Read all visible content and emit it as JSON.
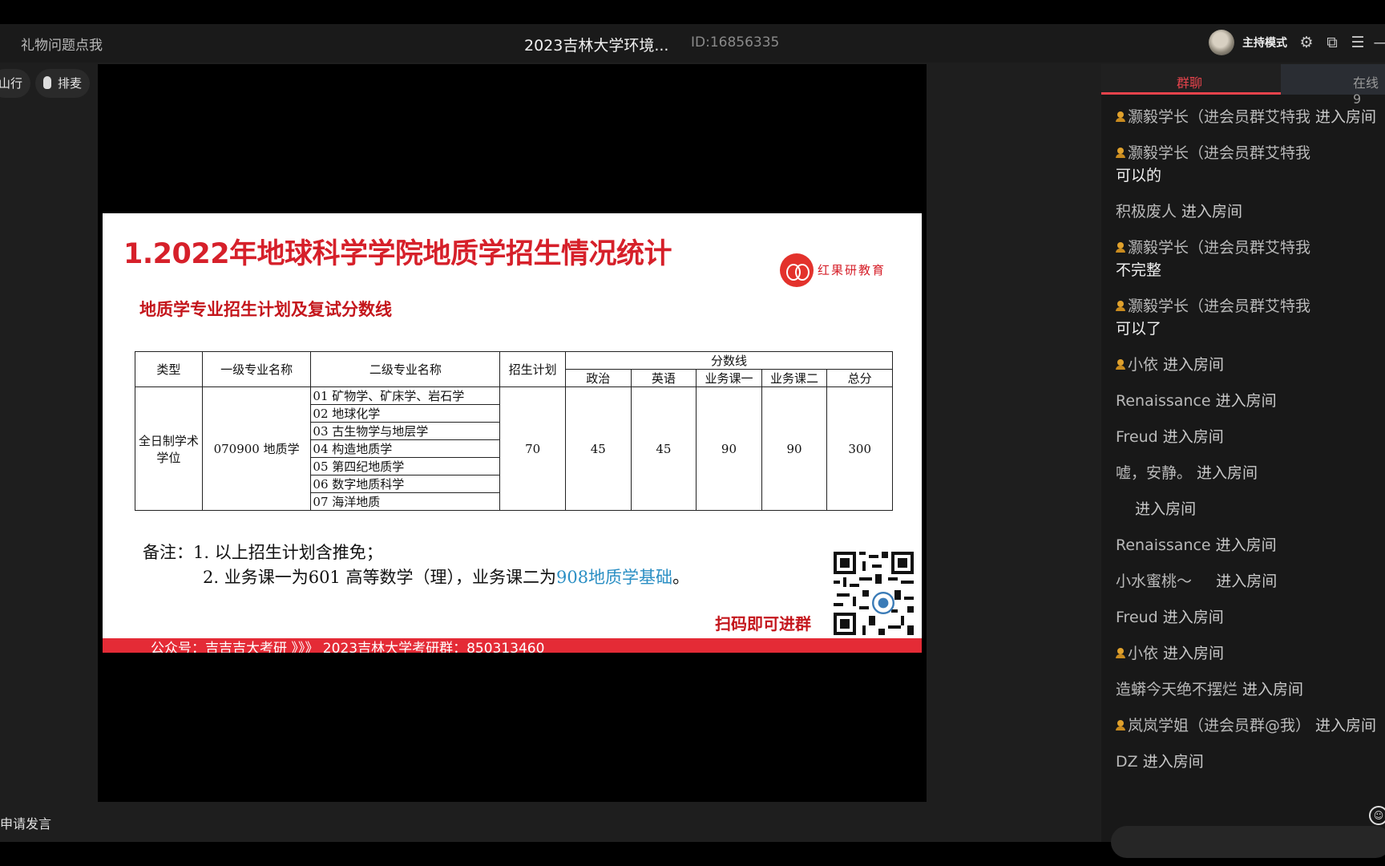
{
  "topbar": {
    "gift_link": "礼物问题点我",
    "room_title": "2023吉林大学环境...",
    "room_id": "ID:16856335",
    "host_mode": "主持模式"
  },
  "left": {
    "pill_1": "山行",
    "pill_2": "排麦",
    "apply_speak": "申请发言"
  },
  "slide": {
    "title": "1.2022年地球科学学院地质学招生情况统计",
    "logo_text": "红果研教育",
    "subtitle": "地质学专业招生计划及复试分数线",
    "table": {
      "h_type": "类型",
      "h_major1": "一级专业名称",
      "h_major2": "二级专业名称",
      "h_plan": "招生计划",
      "h_score": "分数线",
      "h_politics": "政治",
      "h_english": "英语",
      "h_course1": "业务课一",
      "h_course2": "业务课二",
      "h_total": "总分",
      "type": "全日制学术学位",
      "major1": "070900 地质学",
      "sub_majors": [
        "01 矿物学、矿床学、岩石学",
        "02 地球化学",
        "03 古生物学与地层学",
        "04 构造地质学",
        "05 第四纪地质学",
        "06 数字地质科学",
        "07 海洋地质"
      ],
      "plan": "70",
      "politics": "45",
      "english": "45",
      "course1": "90",
      "course2": "90",
      "total": "300"
    },
    "note_label": "备注：",
    "note_1": "1. 以上招生计划含推免；",
    "note_2_prefix": "2. 业务课一为601  高等数学（理），业务课二为",
    "note_2_highlight": "908地质学基础",
    "note_2_suffix": "。",
    "qr_caption": "扫码即可进群",
    "footer": "公众号：吉吉吉大考研   》》》   2023吉林大学考研群：850313460"
  },
  "chat": {
    "tab_group": "群聊",
    "tab_online": "在线9",
    "messages": [
      {
        "badge": true,
        "nick": "灏毅学长（进会员群艾特我",
        "action": " 进入房间",
        "body": ""
      },
      {
        "badge": true,
        "nick": "灏毅学长（进会员群艾特我",
        "action": "",
        "body": "可以的"
      },
      {
        "badge": false,
        "nick": "积极废人",
        "action": " 进入房间",
        "body": ""
      },
      {
        "badge": true,
        "nick": "灏毅学长（进会员群艾特我",
        "action": "",
        "body": "不完整"
      },
      {
        "badge": true,
        "nick": "灏毅学长（进会员群艾特我",
        "action": "",
        "body": "可以了"
      },
      {
        "badge": true,
        "nick": "小依",
        "action": " 进入房间",
        "body": ""
      },
      {
        "badge": false,
        "nick": "Renaissance",
        "action": " 进入房间",
        "body": ""
      },
      {
        "badge": false,
        "nick": "Freud",
        "action": " 进入房间",
        "body": ""
      },
      {
        "badge": false,
        "nick": "嘘，安静。",
        "action": " 进入房间",
        "body": ""
      },
      {
        "badge": false,
        "nick": "",
        "action": "    进入房间",
        "body": ""
      },
      {
        "badge": false,
        "nick": "Renaissance",
        "action": " 进入房间",
        "body": ""
      },
      {
        "badge": false,
        "nick": "小水蜜桃～",
        "action": "     进入房间",
        "body": ""
      },
      {
        "badge": false,
        "nick": "Freud",
        "action": " 进入房间",
        "body": ""
      },
      {
        "badge": true,
        "nick": "小依",
        "action": " 进入房间",
        "body": ""
      },
      {
        "badge": false,
        "nick": "造蟒今天绝不摆烂",
        "action": " 进入房间",
        "body": ""
      },
      {
        "badge": true,
        "nick": "岚岚学姐（进会员群@我）",
        "action": " 进入房间",
        "body": ""
      },
      {
        "badge": false,
        "nick": "DZ",
        "action": " 进入房间",
        "body": ""
      }
    ]
  },
  "colors": {
    "accent_red": "#e6434c",
    "slide_red": "#d6202a",
    "highlight_blue": "#2b8fc4",
    "badge_gold": "#e0a12c"
  },
  "icons": [
    "settings-icon",
    "popout-icon",
    "menu-icon",
    "minimize-icon",
    "mic-icon",
    "emoji-icon",
    "host-badge-icon"
  ]
}
